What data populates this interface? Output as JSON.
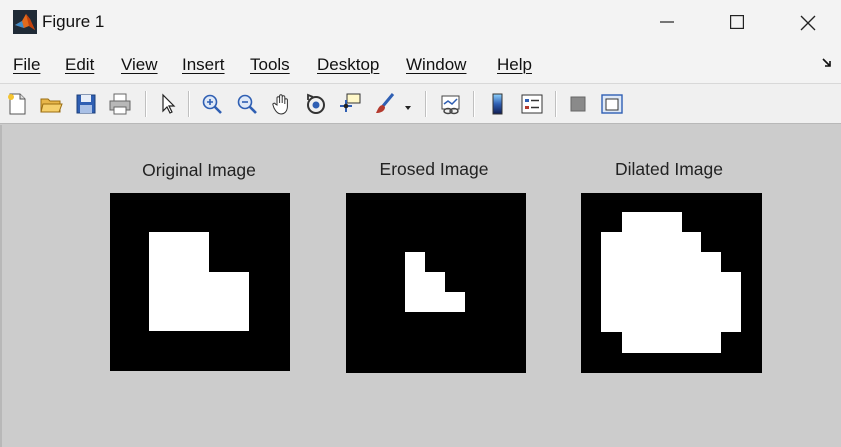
{
  "window": {
    "title": "Figure 1",
    "icon": "matlab-logo-icon"
  },
  "menu": {
    "items": [
      "File",
      "Edit",
      "View",
      "Insert",
      "Tools",
      "Desktop",
      "Window",
      "Help"
    ]
  },
  "toolbar": {
    "icons": [
      "new-figure-icon",
      "open-file-icon",
      "save-icon",
      "print-icon",
      "edit-plot-arrow-icon",
      "zoom-in-icon",
      "zoom-out-icon",
      "pan-hand-icon",
      "rotate-3d-icon",
      "data-cursor-icon",
      "brush-icon",
      "brush-dropdown-icon",
      "link-plot-icon",
      "insert-colorbar-icon",
      "insert-legend-icon",
      "hide-plot-tools-icon",
      "show-plot-tools-icon"
    ]
  },
  "figure": {
    "background": "#cccccc",
    "panels": [
      {
        "title": "Original Image"
      },
      {
        "title": "Erosed Image"
      },
      {
        "title": "Dilated Image"
      }
    ]
  }
}
